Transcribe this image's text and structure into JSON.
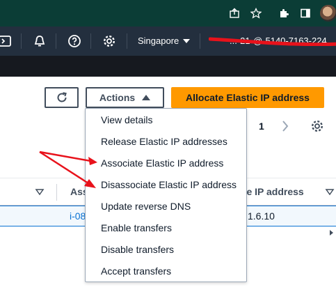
{
  "browser": {
    "icons": [
      "share-icon",
      "star-icon",
      "extensions-icon",
      "sidebar-icon",
      "profile-avatar"
    ]
  },
  "nav": {
    "region_label": "Singapore",
    "account_text": "...-21-@-5140-7163-224"
  },
  "toolbar": {
    "actions_label": "Actions",
    "allocate_label": "Allocate Elastic IP address"
  },
  "pagination": {
    "page": "1"
  },
  "actions_menu": {
    "items": [
      "View details",
      "Release Elastic IP addresses",
      "Associate Elastic IP address",
      "Disassociate Elastic IP address",
      "Update reverse DNS",
      "Enable transfers",
      "Disable transfers",
      "Accept transfers"
    ]
  },
  "table": {
    "headers": [
      "Asso",
      "ate IP address"
    ],
    "row": {
      "instance_fragment": "i-08",
      "ip_fragment": "1.6.10"
    }
  },
  "colors": {
    "primary_button": "#ff9900",
    "nav_background": "#232f3e",
    "annotation_arrow": "#e8121b"
  }
}
